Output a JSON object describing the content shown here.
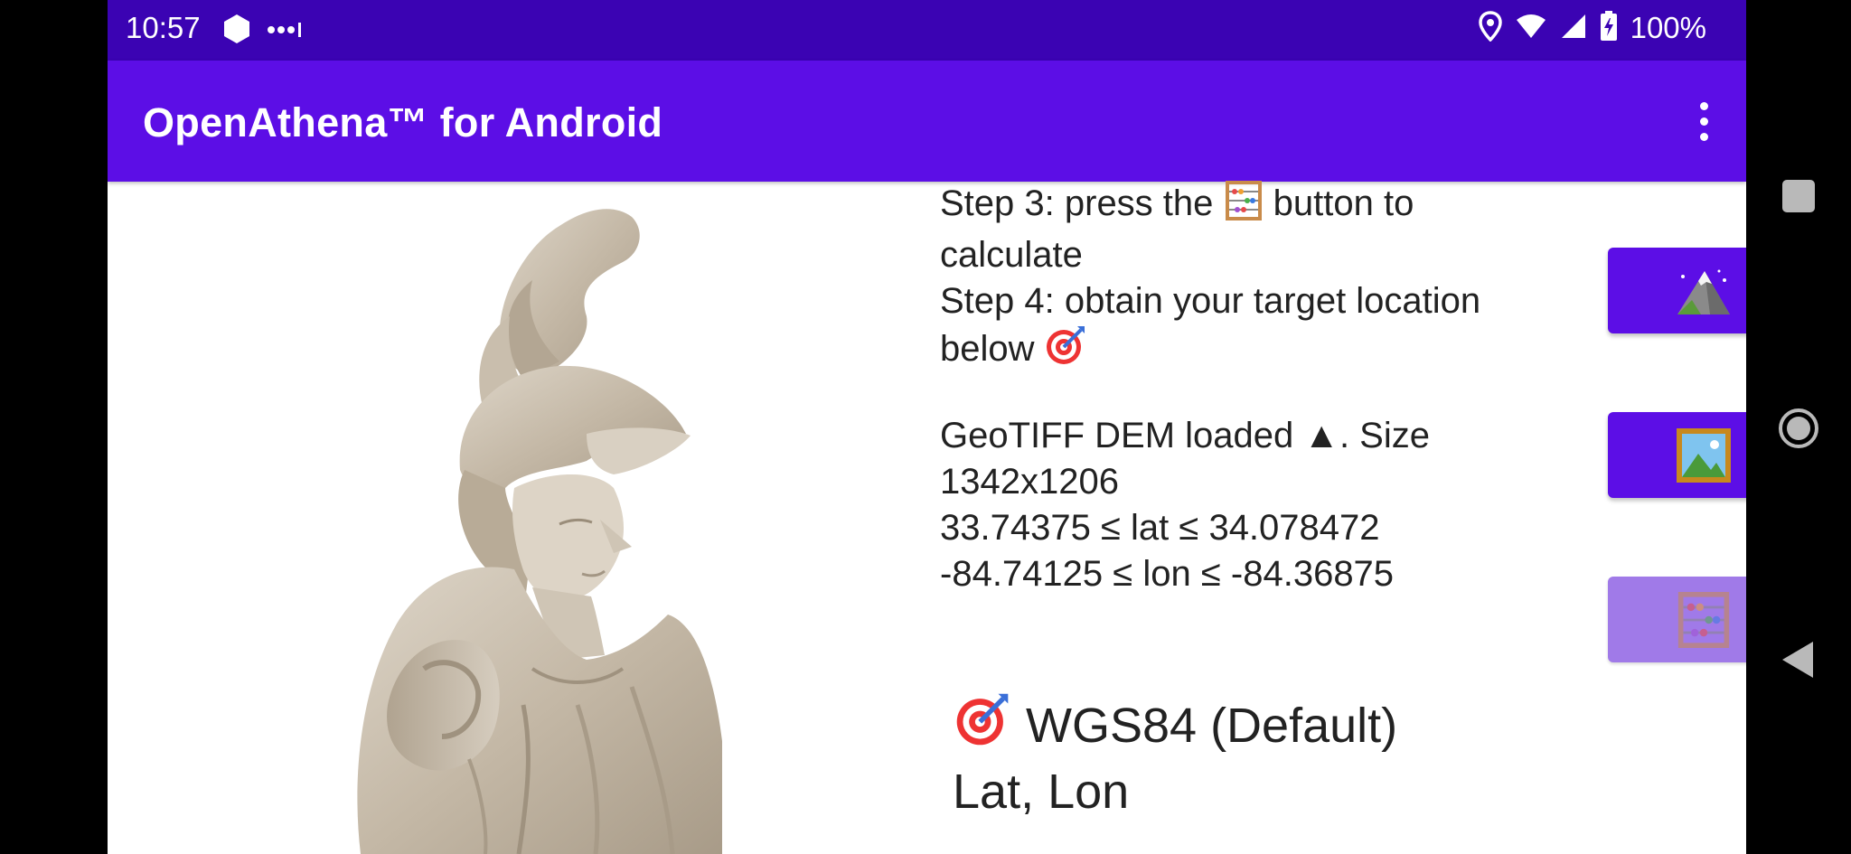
{
  "status_bar": {
    "time": "10:57",
    "battery": "100%"
  },
  "app_bar": {
    "title": "OpenAthena™ for Android"
  },
  "instructions": {
    "step3_before": "Step 3: press the ",
    "step3_after": " button to calculate",
    "step4": "Step 4: obtain your target location below "
  },
  "dem_info": {
    "line1": "GeoTIFF DEM loaded ▲. Size 1342x1206",
    "line2": "33.74375 ≤ lat ≤ 34.078472",
    "line3": "-84.74125 ≤ lon ≤ -84.36875"
  },
  "result": {
    "datum": "WGS84 (Default)",
    "format": "Lat, Lon"
  },
  "buttons": {
    "load_dem_icon": "mountain-icon",
    "select_image_icon": "framed-picture-icon",
    "calculate_icon": "abacus-icon",
    "calculate_enabled": false
  },
  "colors": {
    "status_bar": "#3b03b3",
    "app_bar": "#5c0ee6",
    "button": "#5c0ee6",
    "button_disabled": "#a07ae8"
  }
}
